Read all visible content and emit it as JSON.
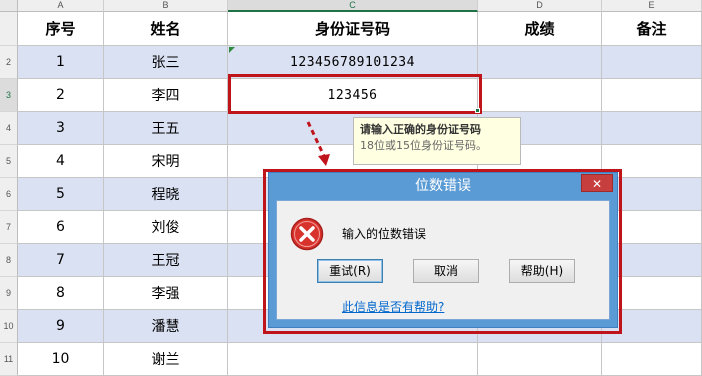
{
  "columns": [
    "A",
    "B",
    "C",
    "D",
    "E"
  ],
  "header_row": {
    "index": "序号",
    "name": "姓名",
    "id_number": "身份证号码",
    "score": "成绩",
    "note": "备注"
  },
  "rows": [
    {
      "rowhdr": "2",
      "index": "1",
      "name": "张三",
      "id_number": "123456789101234"
    },
    {
      "rowhdr": "3",
      "index": "2",
      "name": "李四",
      "id_number": "123456"
    },
    {
      "rowhdr": "4",
      "index": "3",
      "name": "王五",
      "id_number": ""
    },
    {
      "rowhdr": "5",
      "index": "4",
      "name": "宋明",
      "id_number": ""
    },
    {
      "rowhdr": "6",
      "index": "5",
      "name": "程晓",
      "id_number": ""
    },
    {
      "rowhdr": "7",
      "index": "6",
      "name": "刘俊",
      "id_number": ""
    },
    {
      "rowhdr": "8",
      "index": "7",
      "name": "王冠",
      "id_number": ""
    },
    {
      "rowhdr": "9",
      "index": "8",
      "name": "李强",
      "id_number": ""
    },
    {
      "rowhdr": "10",
      "index": "9",
      "name": "潘慧",
      "id_number": ""
    },
    {
      "rowhdr": "11",
      "index": "10",
      "name": "谢兰",
      "id_number": ""
    }
  ],
  "tooltip": {
    "title": "请输入正确的身份证号码",
    "body": "18位或15位身份证号码。"
  },
  "dialog": {
    "title": "位数错误",
    "close": "✕",
    "message": "输入的位数错误",
    "retry": "重试(R)",
    "cancel": "取消",
    "help": "帮助(H)",
    "help_link": "此信息是否有帮助?"
  },
  "colors": {
    "band": "#dae1f2",
    "highlight": "#c0141b",
    "dialog_frame": "#5b9bd5"
  }
}
